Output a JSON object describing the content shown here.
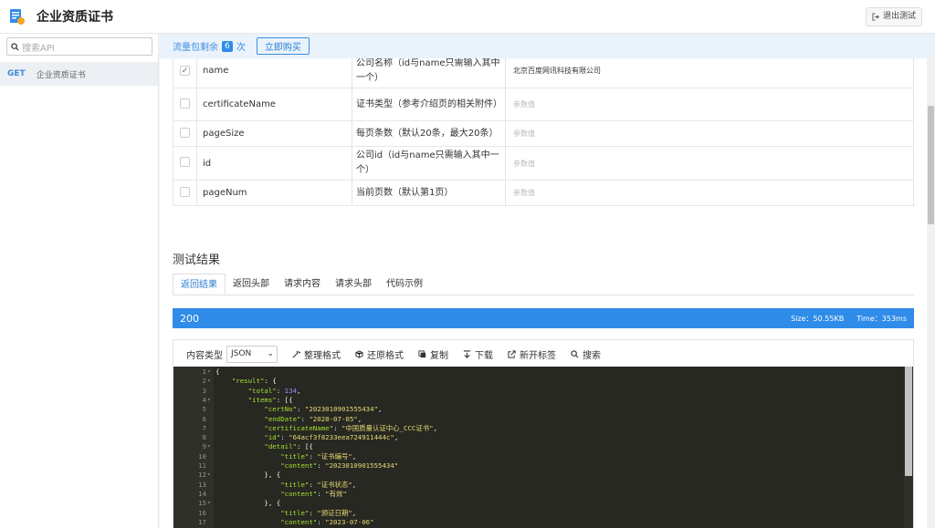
{
  "app": {
    "title": "企业资质证书",
    "exit_label": "退出测试"
  },
  "sidebar": {
    "search_placeholder": "搜索API",
    "items": [
      {
        "method": "GET",
        "name": "企业资质证书"
      }
    ]
  },
  "quota": {
    "prefix": "流量包剩余",
    "count": "6",
    "suffix": "次",
    "buy_label": "立即购买"
  },
  "params": [
    {
      "name": "name",
      "desc": "公司名称（id与name只需输入其中一个）",
      "value": "北京百度网讯科技有限公司",
      "checked": true
    },
    {
      "name": "certificateName",
      "desc": "证书类型（参考介绍页的相关附件）",
      "value": "参数值",
      "checked": false
    },
    {
      "name": "pageSize",
      "desc": "每页条数（默认20条，最大20条）",
      "value": "参数值",
      "checked": false
    },
    {
      "name": "id",
      "desc": "公司id（id与name只需输入其中一个）",
      "value": "参数值",
      "checked": false
    },
    {
      "name": "pageNum",
      "desc": "当前页数（默认第1页）",
      "value": "参数值",
      "checked": false
    }
  ],
  "result": {
    "title": "测试结果",
    "tabs": [
      "返回结果",
      "返回头部",
      "请求内容",
      "请求头部",
      "代码示例"
    ],
    "status_code": "200",
    "size": "Size：50.55KB",
    "time": "Time：353ms"
  },
  "viewer": {
    "content_type_label": "内容类型",
    "content_type_value": "JSON",
    "tools": [
      "整理格式",
      "还原格式",
      "复制",
      "下载",
      "新开标签",
      "搜索"
    ]
  },
  "code_lines": [
    "{",
    "    \"result\": {",
    "        \"total\": 134,",
    "        \"items\": [{",
    "            \"certNo\": \"2023010901555434\",",
    "            \"endDate\": \"2028-07-05\",",
    "            \"certificateName\": \"中国质量认证中心_CCC证书\",",
    "            \"id\": \"64acf3f8233eea724911444c\",",
    "            \"detail\": [{",
    "                \"title\": \"证书编号\",",
    "                \"content\": \"2023010901555434\"",
    "            }, {",
    "                \"title\": \"证书状态\",",
    "                \"content\": \"有效\"",
    "            }, {",
    "                \"title\": \"颁证日期\",",
    "                \"content\": \"2023-07-06\"",
    "            }, {"
  ],
  "fold_lines": [
    1,
    2,
    4,
    9,
    12,
    15
  ]
}
